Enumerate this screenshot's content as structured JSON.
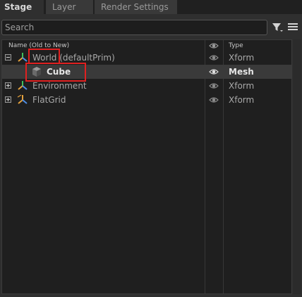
{
  "tabs": [
    {
      "label": "Stage",
      "active": true
    },
    {
      "label": "Layer",
      "active": false
    },
    {
      "label": "Render Settings",
      "active": false
    }
  ],
  "search": {
    "placeholder": "Search"
  },
  "toolbar": {
    "filter_icon": "filter-icon",
    "menu_icon": "hamburger-menu-icon"
  },
  "tree": {
    "columns": {
      "name": "Name (Old to New)",
      "visibility_icon": "eye-icon",
      "type": "Type"
    },
    "rows": [
      {
        "name": "World",
        "suffix": " (defaultPrim)",
        "type": "Xform",
        "expander": "collapse",
        "icon": "xform-axis-icon",
        "highlighted": true
      },
      {
        "name": "Cube",
        "type": "Mesh",
        "icon": "mesh-cube-icon",
        "selected": true,
        "highlighted": true
      },
      {
        "name": "Environment",
        "type": "Xform",
        "expander": "expand",
        "icon": "xform-axis-icon"
      },
      {
        "name": "FlatGrid",
        "type": "Xform",
        "expander": "expand",
        "icon": "grid-xform-icon"
      }
    ]
  },
  "colors": {
    "highlight_box": "#e02020",
    "selected_row": "#3a3a3a"
  }
}
